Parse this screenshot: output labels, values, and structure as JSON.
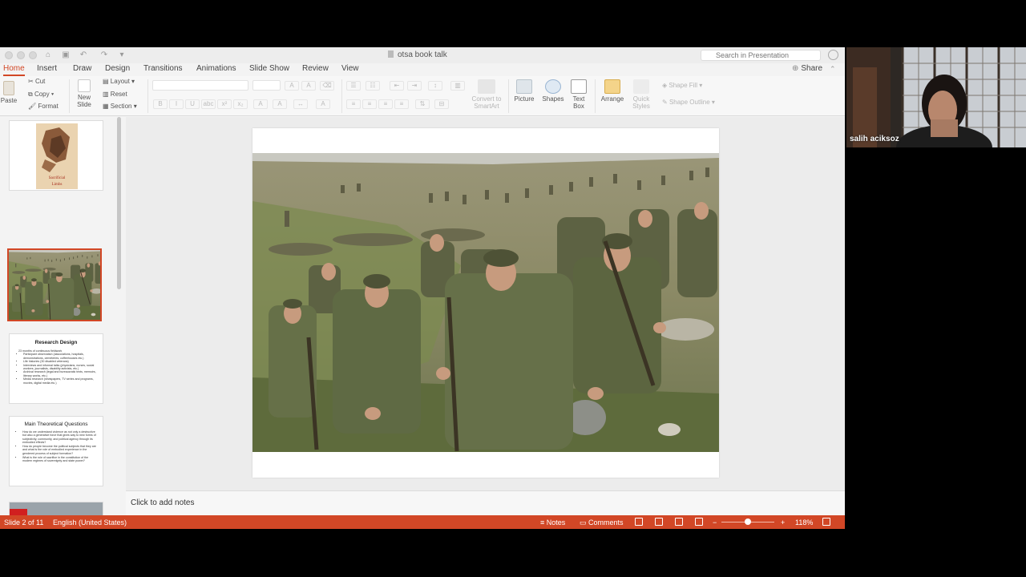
{
  "window": {
    "doc_title": "otsa book talk",
    "search_placeholder": "Search in Presentation",
    "share_label": "Share"
  },
  "tabs": [
    "Home",
    "Insert",
    "Draw",
    "Design",
    "Transitions",
    "Animations",
    "Slide Show",
    "Review",
    "View"
  ],
  "ribbon": {
    "paste": "Paste",
    "cut": "Cut",
    "copy": "Copy",
    "format": "Format",
    "new_slide": [
      "New",
      "Slide"
    ],
    "layout": "Layout",
    "reset": "Reset",
    "section": "Section",
    "convert_smartart": [
      "Convert to",
      "SmartArt"
    ],
    "picture": "Picture",
    "shapes": "Shapes",
    "text_box": [
      "Text",
      "Box"
    ],
    "arrange": "Arrange",
    "quick_styles": [
      "Quick",
      "Styles"
    ],
    "shape_fill": "Shape Fill",
    "shape_outline": "Shape Outline",
    "font_buttons": [
      "B",
      "I",
      "U",
      "abc",
      "x²",
      "x₂",
      "A",
      "A"
    ]
  },
  "thumbnails": {
    "slide1_title": "Sacrificial",
    "slide1_subtitle": "Limbs",
    "slide3_title": "Research Design",
    "slide3_intro": "23 months of continuous fieldwork",
    "slide3_bullets": [
      "Participant observation (associations, hospitals, demonstrations, cemeteries, coffeehouses etc.)",
      "Life histories (30 disabled veterans)",
      "Interviews and informal talks (physicians, nurses, social workers, journalists, disability activists, etc.)",
      "Archival research (legal and bureaucratic texts, memoirs, literary works, etc.)",
      "Media research (newspapers, TV series and programs, movies, digital media etc.)"
    ],
    "slide4_title": "Main Theoretical Questions",
    "slide4_bullets": [
      "How do we understand violence as not only a destructive but also a generative force that gives way to new forms of subjectivity, community, and political agency through its embodied effects?",
      "How do people become the political subjects that they are and what is the role of embodied experience in the gendered process of subject formation?",
      "What is the role of sacrifice in the constitution of the modern regimes of sovereignty and state power?"
    ]
  },
  "notes_placeholder": "Click to add notes",
  "status": {
    "slide_counter": "Slide 2 of 11",
    "language": "English (United States)",
    "notes": "Notes",
    "comments": "Comments",
    "zoom": "118%",
    "zoom_fraction": 0.5
  },
  "webcam": {
    "participant_name": "salih aciksoz"
  },
  "colors": {
    "accent": "#d24726",
    "status_bar": "#d24726"
  }
}
